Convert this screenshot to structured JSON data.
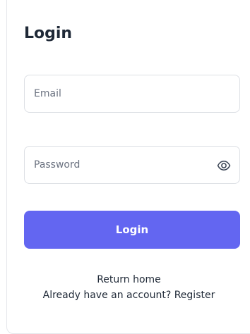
{
  "form": {
    "title": "Login",
    "email": {
      "placeholder": "Email",
      "value": ""
    },
    "password": {
      "placeholder": "Password",
      "value": "",
      "toggle_icon": "eye-icon"
    },
    "submit_label": "Login"
  },
  "links": {
    "return_home": "Return home",
    "register_prompt": "Already have an account? Register"
  },
  "colors": {
    "accent": "#6366f1",
    "border": "#dcdfe4",
    "text": "#1f2937",
    "placeholder": "#6b7280"
  }
}
